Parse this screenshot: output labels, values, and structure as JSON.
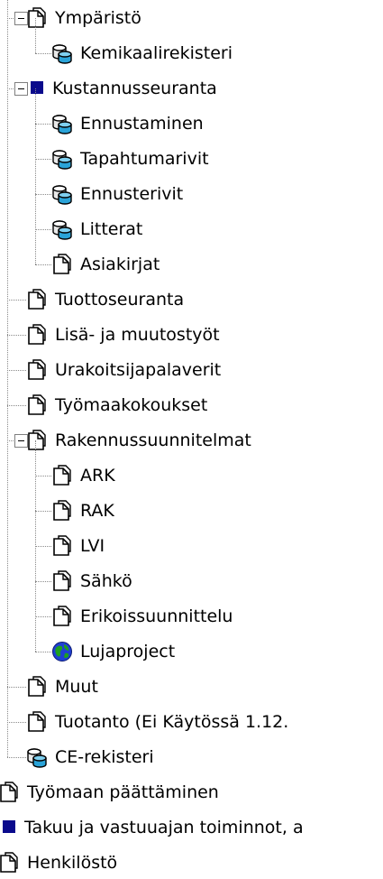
{
  "tree": {
    "items": [
      {
        "label": "Ympäristö",
        "icon": "page-icon",
        "level": 1,
        "expander": "collapse"
      },
      {
        "label": "Kemikaalirekisteri",
        "icon": "database-icon",
        "level": 2
      },
      {
        "label": "Kustannusseuranta",
        "icon": "blue-square-icon",
        "level": 1,
        "expander": "collapse"
      },
      {
        "label": "Ennustaminen",
        "icon": "database-icon",
        "level": 2
      },
      {
        "label": "Tapahtumarivit",
        "icon": "database-icon",
        "level": 2
      },
      {
        "label": "Ennusterivit",
        "icon": "database-icon",
        "level": 2
      },
      {
        "label": "Litterat",
        "icon": "database-icon",
        "level": 2
      },
      {
        "label": "Asiakirjat",
        "icon": "page-icon",
        "level": 2
      },
      {
        "label": "Tuottoseuranta",
        "icon": "page-icon",
        "level": 1
      },
      {
        "label": "Lisä- ja muutostyöt",
        "icon": "page-icon",
        "level": 1
      },
      {
        "label": "Urakoitsijapalaverit",
        "icon": "page-icon",
        "level": 1
      },
      {
        "label": "Työmaakokoukset",
        "icon": "page-icon",
        "level": 1
      },
      {
        "label": "Rakennussuunnitelmat",
        "icon": "page-icon",
        "level": 1,
        "expander": "collapse"
      },
      {
        "label": "ARK",
        "icon": "page-icon",
        "level": 2
      },
      {
        "label": "RAK",
        "icon": "page-icon",
        "level": 2
      },
      {
        "label": "LVI",
        "icon": "page-icon",
        "level": 2
      },
      {
        "label": "Sähkö",
        "icon": "page-icon",
        "level": 2
      },
      {
        "label": "Erikoissuunnittelu",
        "icon": "page-icon",
        "level": 2
      },
      {
        "label": "Lujaproject",
        "icon": "globe-icon",
        "level": 2
      },
      {
        "label": "Muut",
        "icon": "page-icon",
        "level": 1
      },
      {
        "label": "Tuotanto  (Ei Käytössä 1.12.",
        "icon": "page-icon",
        "level": 1
      },
      {
        "label": "CE-rekisteri",
        "icon": "database-icon",
        "level": 1
      },
      {
        "label": "Työmaan päättäminen",
        "icon": "page-icon",
        "level": 0
      },
      {
        "label": "Takuu ja vastuuajan toiminnot, a",
        "icon": "blue-square-icon",
        "level": 0
      },
      {
        "label": "Henkilöstö",
        "icon": "page-icon",
        "level": 0
      }
    ]
  },
  "colors": {
    "treeline": "#8a8a8a",
    "square": "#0a0a8c",
    "dbBlue": "#2aa3d8",
    "globeBlue": "#1f3fd4",
    "globeGreen": "#1fa01f"
  }
}
